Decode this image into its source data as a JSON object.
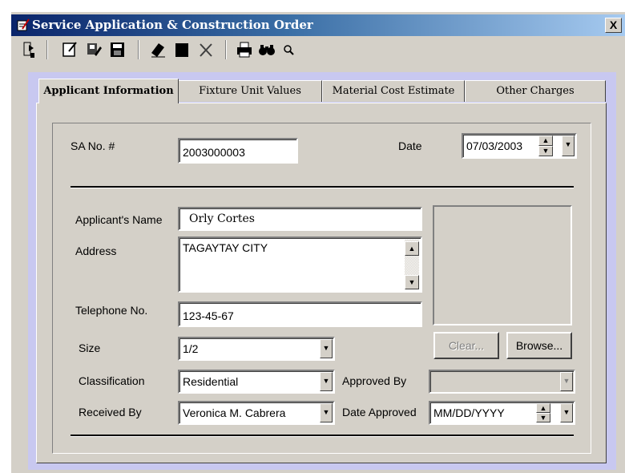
{
  "window": {
    "title": "Service Application & Construction Order",
    "close_label": "X"
  },
  "toolbar": {
    "icons": [
      "exit-icon",
      "new-icon",
      "edit-icon",
      "save-icon",
      "erase-icon",
      "stop-icon",
      "delete-icon",
      "print-icon",
      "find-icon",
      "zoom-icon"
    ]
  },
  "tabs": [
    {
      "label": "Applicant Information",
      "active": true
    },
    {
      "label": "Fixture Unit Values",
      "active": false
    },
    {
      "label": "Material Cost Estimate",
      "active": false
    },
    {
      "label": "Other Charges",
      "active": false
    }
  ],
  "form": {
    "sa_no_label": "SA No. #",
    "sa_no_value": "2003000003",
    "date_label": "Date",
    "date_value": "07/03/2003",
    "applicant_name_label": "Applicant's Name",
    "applicant_name_value": "Orly Cortes",
    "address_label": "Address",
    "address_value": "TAGAYTAY CITY",
    "telephone_label": "Telephone No.",
    "telephone_value": "123-45-67",
    "size_label": "Size",
    "size_value": "1/2",
    "classification_label": "Classification",
    "classification_value": "Residential",
    "received_by_label": "Received By",
    "received_by_value": "Veronica M. Cabrera",
    "approved_by_label": "Approved By",
    "approved_by_value": "",
    "date_approved_label": "Date Approved",
    "date_approved_value": "MM/DD/YYYY"
  },
  "buttons": {
    "clear_label": "Clear...",
    "browse_label": "Browse..."
  },
  "colors": {
    "title_bar_start": "#0a246a",
    "title_bar_end": "#a6caf0",
    "panel": "#d4d0c8",
    "tab_area": "#c8c8f0"
  }
}
